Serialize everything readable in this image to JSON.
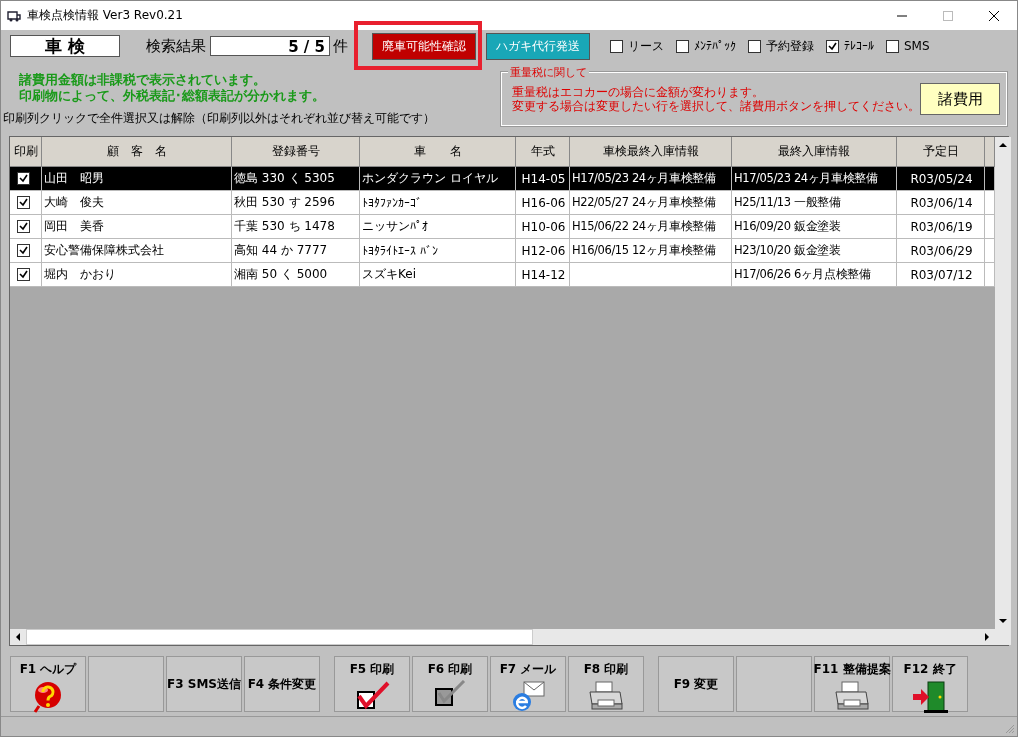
{
  "window": {
    "title": "車検点検情報 Ver3 Rev0.21"
  },
  "mode_label": "車 検",
  "search_result": {
    "label": "検索結果",
    "value": "5 / 5",
    "unit": "件"
  },
  "action_buttons": [
    {
      "label": "廃車可能性確認",
      "highlighted": true
    },
    {
      "label": "ハガキ代行発送",
      "highlighted": false
    }
  ],
  "filters": [
    {
      "label": "リース",
      "checked": false
    },
    {
      "label": "ﾒﾝﾃﾊﾟｯｸ",
      "checked": false
    },
    {
      "label": "予約登録",
      "checked": false
    },
    {
      "label": "ﾃﾚｺｰﾙ",
      "checked": true
    },
    {
      "label": "SMS",
      "checked": false
    }
  ],
  "notices": [
    "諸費用金額は非課税で表示されています。",
    "印刷物によって、外税表記･総額表記が分かれます。"
  ],
  "weight_tax": {
    "title": "重量税に関して",
    "lines": [
      "重量税はエコカーの場合に金額が変わります。",
      "変更する場合は変更したい行を選択して、諸費用ボタンを押してください。"
    ],
    "button": "諸費用"
  },
  "hint": "印刷列クリックで全件選択又は解除（印刷列以外はそれぞれ並び替え可能です）",
  "table": {
    "print_column": "印刷",
    "columns": [
      "顧　客　名",
      "登録番号",
      "車　　名",
      "年式",
      "車検最終入庫情報",
      "最終入庫情報",
      "予定日"
    ],
    "rows": [
      {
        "print": true,
        "selected": true,
        "cells": [
          "山田　昭男",
          "徳島 330 く 5305",
          "ホンダクラウン ロイヤル",
          "H14-05",
          "H17/05/23 24ヶ月車検整備",
          "H17/05/23 24ヶ月車検整備",
          "R03/05/24"
        ]
      },
      {
        "print": true,
        "selected": false,
        "cells": [
          "大崎　俊夫",
          "秋田 530 す 2596",
          "ﾄﾖﾀﾌｧﾝｶｰｺﾞ",
          "H16-06",
          "H22/05/27 24ヶ月車検整備",
          "H25/11/13 一般整備",
          "R03/06/14"
        ]
      },
      {
        "print": true,
        "selected": false,
        "cells": [
          "岡田　美香",
          "千葉 530 ち 1478",
          "ニッサンﾊﾟｵ",
          "H10-06",
          "H15/06/22 24ヶ月車検整備",
          "H16/09/20 鈑金塗装",
          "R03/06/19"
        ]
      },
      {
        "print": true,
        "selected": false,
        "cells": [
          "安心警備保障株式会社",
          "高知 44 か 7777",
          "ﾄﾖﾀﾗｲﾄｴｰｽ ﾊﾞﾝ",
          "H12-06",
          "H16/06/15 12ヶ月車検整備",
          "H23/10/20 鈑金塗装",
          "R03/06/29"
        ]
      },
      {
        "print": true,
        "selected": false,
        "cells": [
          "堀内　かおり",
          "湘南 50 く 5000",
          "スズキKei",
          "H14-12",
          "",
          "H17/06/26 6ヶ月点検整備",
          "R03/07/12"
        ]
      }
    ]
  },
  "function_keys": [
    {
      "label": "F1 ヘルプ",
      "kind": "help"
    },
    {
      "kind": "blank"
    },
    {
      "label": "F3 SMS送信",
      "kind": "text"
    },
    {
      "label": "F4 条件変更",
      "kind": "text"
    },
    {
      "label": "F5 印刷",
      "kind": "check"
    },
    {
      "label": "F6 印刷",
      "kind": "uncheck"
    },
    {
      "label": "F7 メール",
      "kind": "mail"
    },
    {
      "label": "F8 印刷",
      "kind": "printer"
    },
    {
      "label": "F9 変更",
      "kind": "text"
    },
    {
      "kind": "blank"
    },
    {
      "label": "F11 整備提案",
      "kind": "printer"
    },
    {
      "label": "F12 終了",
      "kind": "exit"
    }
  ]
}
